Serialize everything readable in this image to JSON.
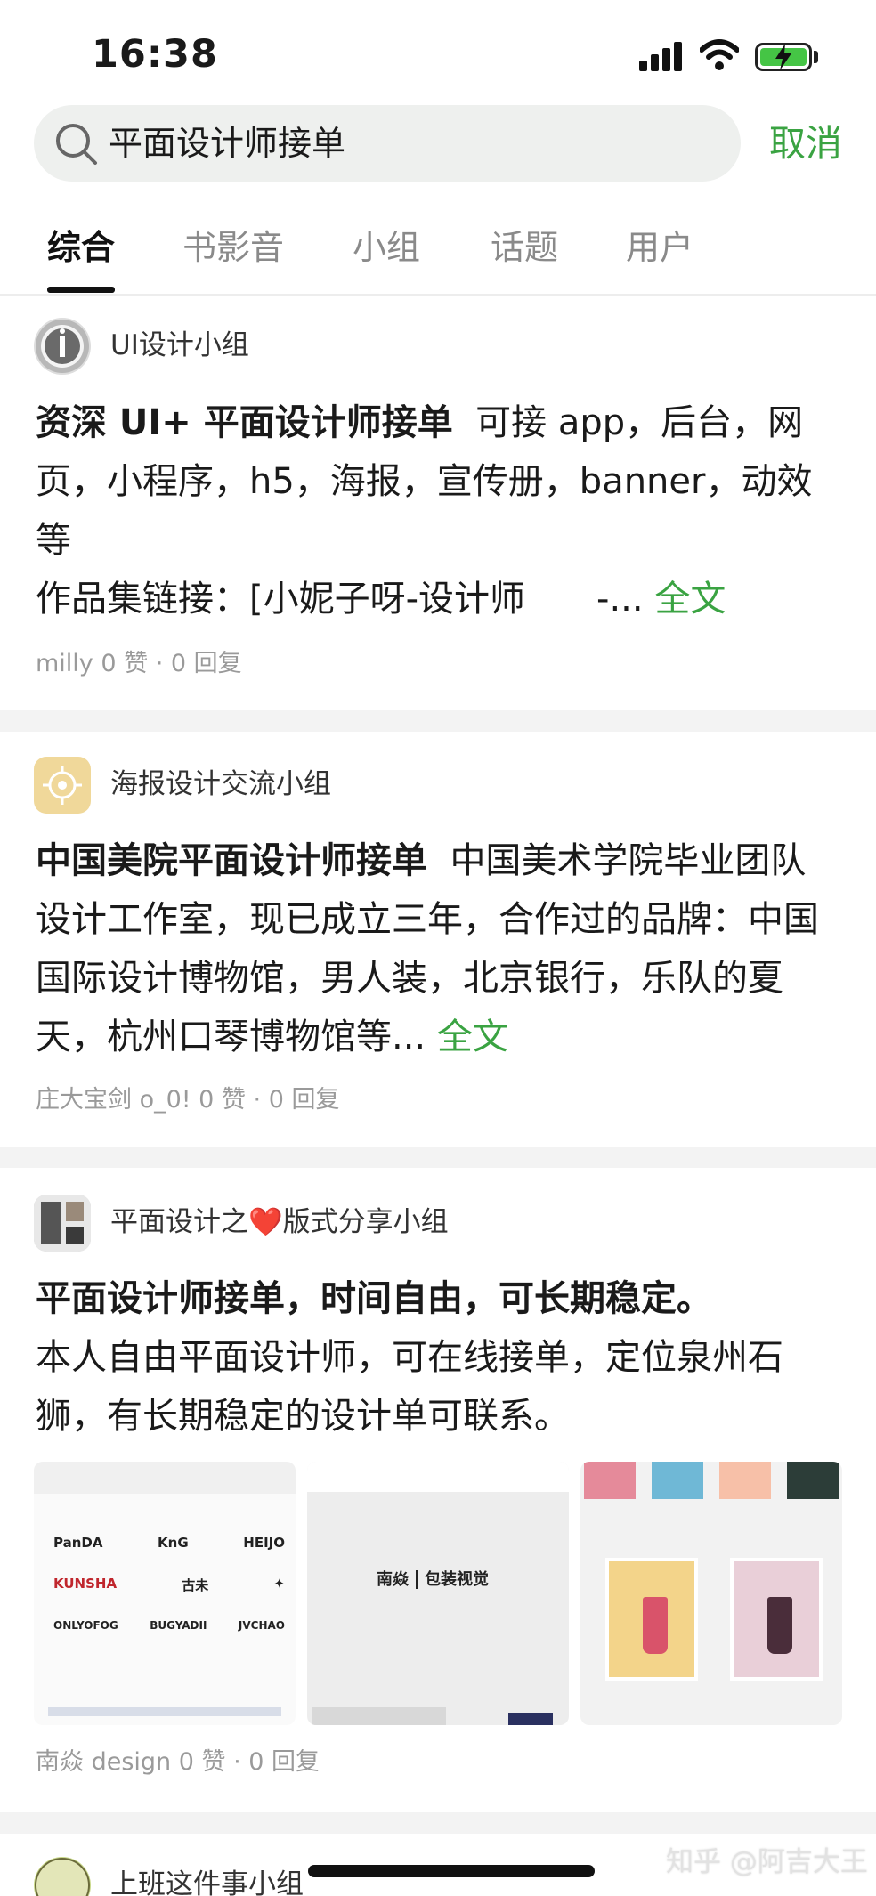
{
  "status_bar": {
    "time": "16:38"
  },
  "search": {
    "query": "平面设计师接单",
    "cancel_label": "取消"
  },
  "tabs": [
    {
      "label": "综合",
      "active": true
    },
    {
      "label": "书影音",
      "active": false
    },
    {
      "label": "小组",
      "active": false
    },
    {
      "label": "话题",
      "active": false
    },
    {
      "label": "用户",
      "active": false
    }
  ],
  "posts": [
    {
      "group": "UI设计小组",
      "title": "资深 UI+ 平面设计师接单",
      "body_line1": "可接 app，后台，网",
      "body_rest": "页，小程序，h5，海报，宣传册，banner，动效等",
      "body_line4": "作品集链接：[小妮子呀-设计师　　-...",
      "more": "全文",
      "meta": "milly 0 赞 · 0 回复"
    },
    {
      "group": "海报设计交流小组",
      "title": "中国美院平面设计师接单",
      "body": "中国美术学院毕业团队设计工作室，现已成立三年，合作过的品牌：中国国际设计博物馆，男人装，北京银行，乐队的夏天，杭州口琴博物馆等...",
      "more": "全文",
      "meta": "庄大宝剑 o_0!  0 赞 · 0 回复"
    },
    {
      "group_prefix": "平面设计之",
      "group_suffix": "版式分享小组",
      "title": "平面设计师接单，时间自由，可长期稳定。",
      "body": "本人自由平面设计师，可在线接单，定位泉州石狮，有长期稳定的设计单可联系。",
      "meta": "南焱 design 0 赞 · 0 回复",
      "image2_caption": "包装视觉",
      "logos": [
        "PanDA",
        "KnG",
        "HEIJO",
        "KUNSHA",
        "古未",
        "",
        "ONLYOFOG",
        "BUGYADII",
        "JVCHAO"
      ]
    },
    {
      "group": "上班这件事小组"
    }
  ],
  "watermark": "知乎 @阿吉大王",
  "colors": {
    "accent": "#3aa342",
    "divider": "#f3f3f3",
    "search_bg": "#eef0ee"
  }
}
